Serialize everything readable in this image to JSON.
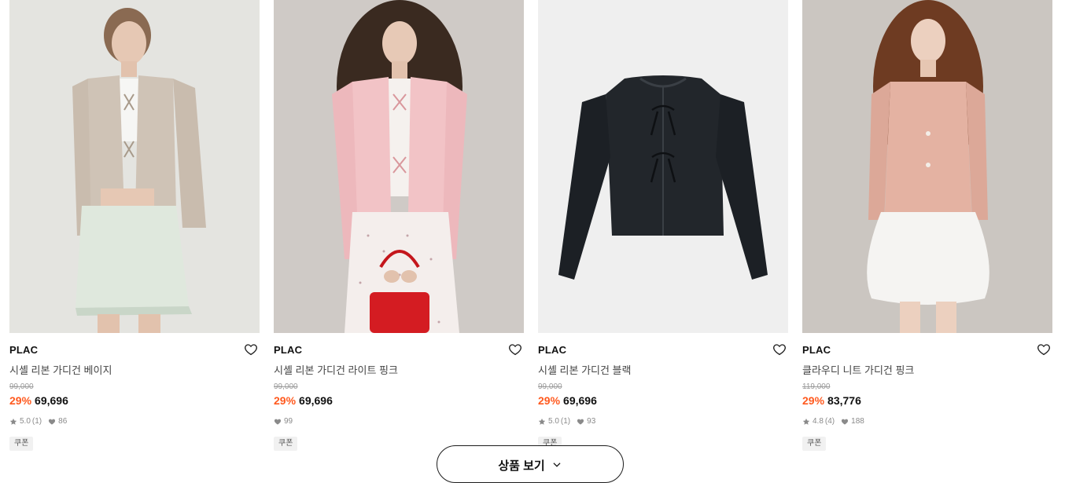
{
  "products": [
    {
      "brand": "PLAC",
      "name": "시셸 리본 가디건 베이지",
      "original_price": "99,000",
      "discount": "29%",
      "price": "69,696",
      "rating": "5.0",
      "review_count": "(1)",
      "likes": "86",
      "badge": "쿠폰",
      "image": "model-beige-cardigan"
    },
    {
      "brand": "PLAC",
      "name": "시셸 리본 가디건 라이트 핑크",
      "original_price": "99,000",
      "discount": "29%",
      "price": "69,696",
      "rating": "",
      "review_count": "",
      "likes": "99",
      "badge": "쿠폰",
      "image": "model-pink-cardigan"
    },
    {
      "brand": "PLAC",
      "name": "시셸 리본 가디건 블랙",
      "original_price": "99,000",
      "discount": "29%",
      "price": "69,696",
      "rating": "5.0",
      "review_count": "(1)",
      "likes": "93",
      "badge": "쿠폰",
      "image": "flat-black-cardigan"
    },
    {
      "brand": "PLAC",
      "name": "클라우디 니트 가디건 핑크",
      "original_price": "119,000",
      "discount": "29%",
      "price": "83,776",
      "rating": "4.8",
      "review_count": "(4)",
      "likes": "188",
      "badge": "쿠폰",
      "image": "model-pink-knit"
    }
  ],
  "more_button": {
    "label": "상품 보기"
  },
  "icons": {
    "wishlist": "heart-outline-icon",
    "rating": "star-icon",
    "likes": "heart-filled-icon",
    "more": "chevron-down-icon"
  },
  "colors": {
    "discount": "#ff5a1f",
    "price": "#111111",
    "muted": "#8a8a8a"
  }
}
